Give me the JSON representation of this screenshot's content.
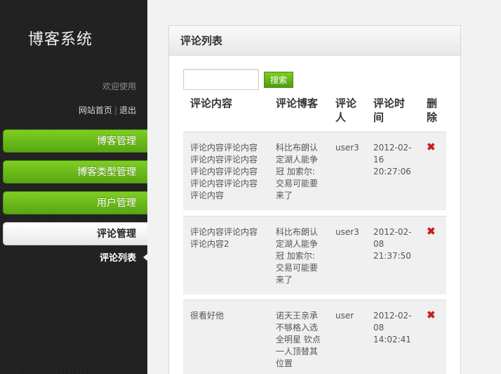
{
  "brand": "博客系统",
  "welcome": "欢迎使用",
  "toplinks": {
    "home": "网站首页",
    "separator": "|",
    "logout": "退出"
  },
  "nav": [
    {
      "label": "博客管理"
    },
    {
      "label": "博客类型管理"
    },
    {
      "label": "用户管理"
    },
    {
      "label": "评论管理"
    }
  ],
  "subnav": {
    "label": "评论列表"
  },
  "panel": {
    "title": "评论列表"
  },
  "search": {
    "button": "搜索",
    "value": ""
  },
  "table": {
    "headers": [
      "评论内容",
      "评论博客",
      "评论人",
      "评论时间",
      "删除"
    ],
    "rows": [
      {
        "content": "评论内容评论内容评论内容评论内容评论内容评论内容评论内容评论内容评论内容",
        "blog": "科比布朗认定湖人能争冠 加索尔:交易可能要来了",
        "user": "user3",
        "time": "2012-02-16 20:27:06"
      },
      {
        "content": "评论内容评论内容评论内容2",
        "blog": "科比布朗认定湖人能争冠 加索尔:交易可能要来了",
        "user": "user3",
        "time": "2012-02-08 21:37:50"
      },
      {
        "content": "很看好他",
        "blog": "诺天王亲承不够格入选全明星 钦点一人顶替其位置",
        "user": "user",
        "time": "2012-02-08 14:02:41"
      }
    ],
    "delete_icon": "✖"
  },
  "colors": {
    "accent_green": "#6bbf1a",
    "delete_red": "#cc1a1a"
  }
}
